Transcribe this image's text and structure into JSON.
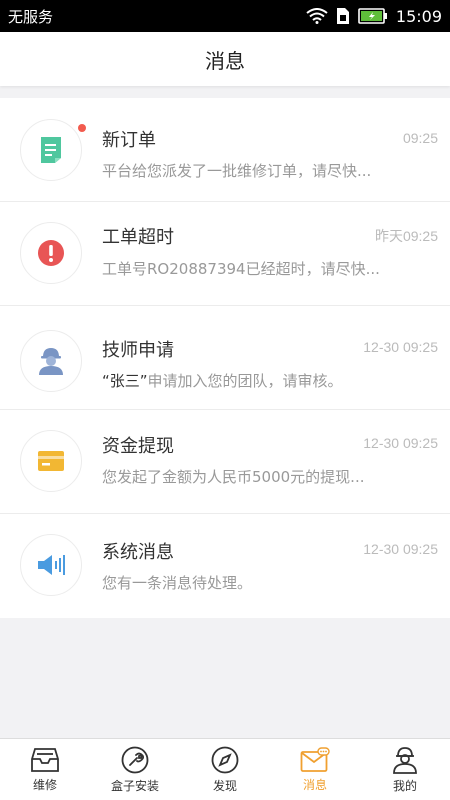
{
  "status_bar": {
    "carrier": "无服务",
    "time": "15:09"
  },
  "header": {
    "title": "消息"
  },
  "messages": [
    {
      "title": "新订单",
      "time": "09:25",
      "preview": "平台给您派发了一批维修订单，请尽快...",
      "unread": true,
      "icon": "document-icon",
      "icon_color": "#4fc79e"
    },
    {
      "title": "工单超时",
      "time": "昨天09:25",
      "preview": "工单号RO20887394已经超时，请尽快...",
      "unread": false,
      "icon": "alert-icon",
      "icon_color": "#e85555"
    },
    {
      "title": "技师申请",
      "time": "12-30 09:25",
      "preview_quote": "“张三”",
      "preview": "申请加入您的团队，请审核。",
      "unread": false,
      "icon": "worker-icon",
      "icon_color": "#7a95c4"
    },
    {
      "title": "资金提现",
      "time": "12-30 09:25",
      "preview": "您发起了金额为人民币5000元的提现...",
      "unread": false,
      "icon": "card-icon",
      "icon_color": "#f2b733"
    },
    {
      "title": "系统消息",
      "time": "12-30 09:25",
      "preview": "您有一条消息待处理。",
      "unread": false,
      "icon": "speaker-icon",
      "icon_color": "#4a9be0"
    }
  ],
  "tabs": [
    {
      "label": "维修",
      "icon": "inbox-icon",
      "active": false
    },
    {
      "label": "盒子安装",
      "icon": "wrench-icon",
      "active": false
    },
    {
      "label": "发现",
      "icon": "compass-icon",
      "active": false
    },
    {
      "label": "消息",
      "icon": "message-icon",
      "active": true
    },
    {
      "label": "我的",
      "icon": "user-icon",
      "active": false
    }
  ],
  "colors": {
    "accent": "#f0a030",
    "unread_dot": "#f25b4e"
  }
}
